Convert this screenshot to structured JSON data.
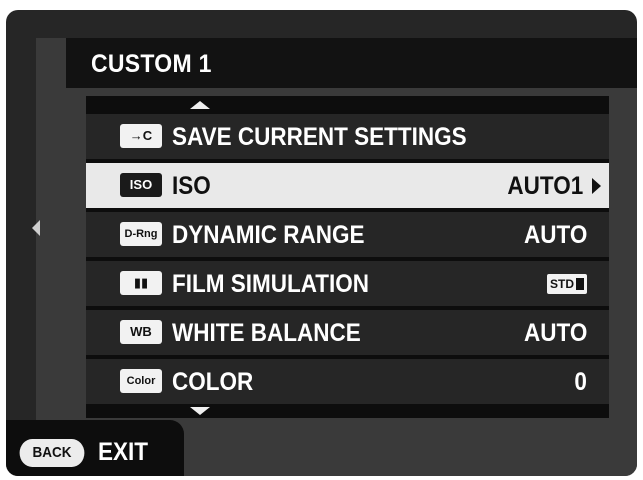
{
  "header": {
    "title": "CUSTOM 1"
  },
  "menu": {
    "items": [
      {
        "icon_text": "→C",
        "icon_name": "save-settings-icon",
        "label": "SAVE CURRENT SETTINGS",
        "value": ""
      },
      {
        "icon_text": "ISO",
        "icon_name": "iso-icon",
        "label": "ISO",
        "value": "AUTO1",
        "selected": true
      },
      {
        "icon_text": "D-Rng",
        "icon_name": "dynamic-range-icon",
        "label": "DYNAMIC RANGE",
        "value": "AUTO"
      },
      {
        "icon_text": "▮▮",
        "icon_name": "film-simulation-icon",
        "label": "FILM SIMULATION",
        "value_icon": "STD",
        "value_icon_name": "std-film-icon"
      },
      {
        "icon_text": "WB",
        "icon_name": "white-balance-icon",
        "label": "WHITE BALANCE",
        "value": "AUTO"
      },
      {
        "icon_text": "Color",
        "icon_name": "color-icon",
        "label": "COLOR",
        "value": "0"
      }
    ]
  },
  "footer": {
    "back_label": "BACK",
    "exit_label": "EXIT"
  }
}
